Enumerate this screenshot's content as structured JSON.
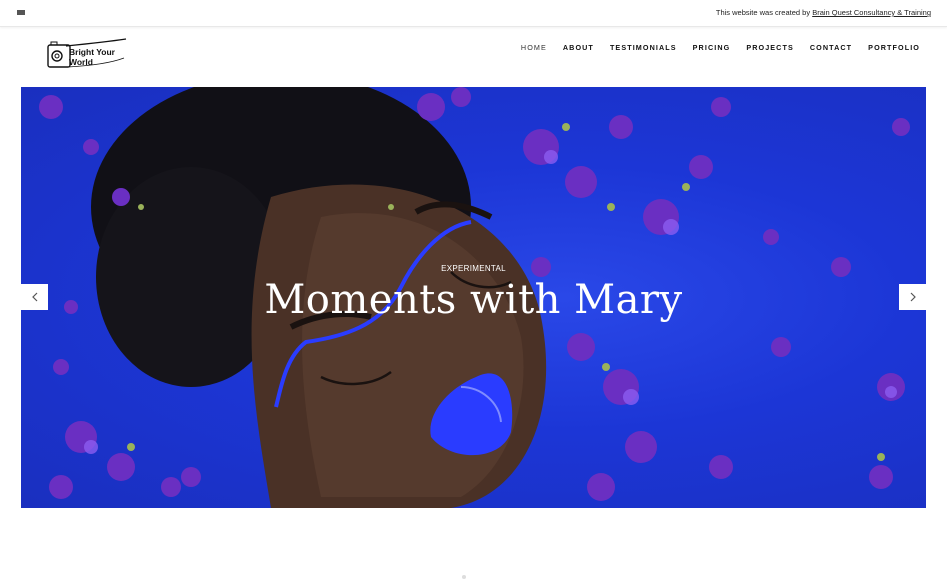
{
  "banner": {
    "credit_prefix": "This website was created by",
    "credit_link": "Brain Quest Consultancy & Training"
  },
  "brand": {
    "line1": "Bright Your",
    "line2": "World"
  },
  "nav": {
    "items": [
      {
        "label": "HOME",
        "active": true
      },
      {
        "label": "ABOUT"
      },
      {
        "label": "TESTIMONIALS"
      },
      {
        "label": "PRICING"
      },
      {
        "label": "PROJECTS"
      },
      {
        "label": "CONTACT"
      },
      {
        "label": "PORTFOLIO"
      }
    ]
  },
  "hero": {
    "eyebrow": "EXPERIMENTAL",
    "title": "Moments with Mary",
    "prev_icon": "chevron-left-icon",
    "next_icon": "chevron-right-icon"
  },
  "colors": {
    "hero_blue": "#1c36d6",
    "flower_purple": "#6a2fc2",
    "lip_blue": "#2a3cff",
    "skin": "#4a3126"
  }
}
